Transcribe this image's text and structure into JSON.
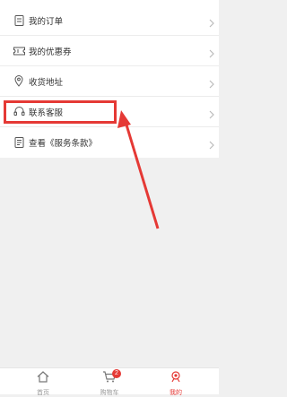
{
  "menu": {
    "items": [
      {
        "label": "我的订单",
        "icon": "order-icon"
      },
      {
        "label": "我的优惠券",
        "icon": "coupon-icon"
      },
      {
        "label": "收货地址",
        "icon": "location-icon"
      },
      {
        "label": "联系客服",
        "icon": "customer-service-icon"
      },
      {
        "label": "查看《服务条款》",
        "icon": "terms-icon"
      }
    ]
  },
  "tabbar": {
    "tabs": [
      {
        "label": "首页",
        "icon": "home-icon"
      },
      {
        "label": "购物车",
        "icon": "cart-icon",
        "badge": "2"
      },
      {
        "label": "我的",
        "icon": "profile-icon",
        "active": true
      }
    ]
  },
  "colors": {
    "accent": "#e53935",
    "background": "#f0f0f0"
  }
}
